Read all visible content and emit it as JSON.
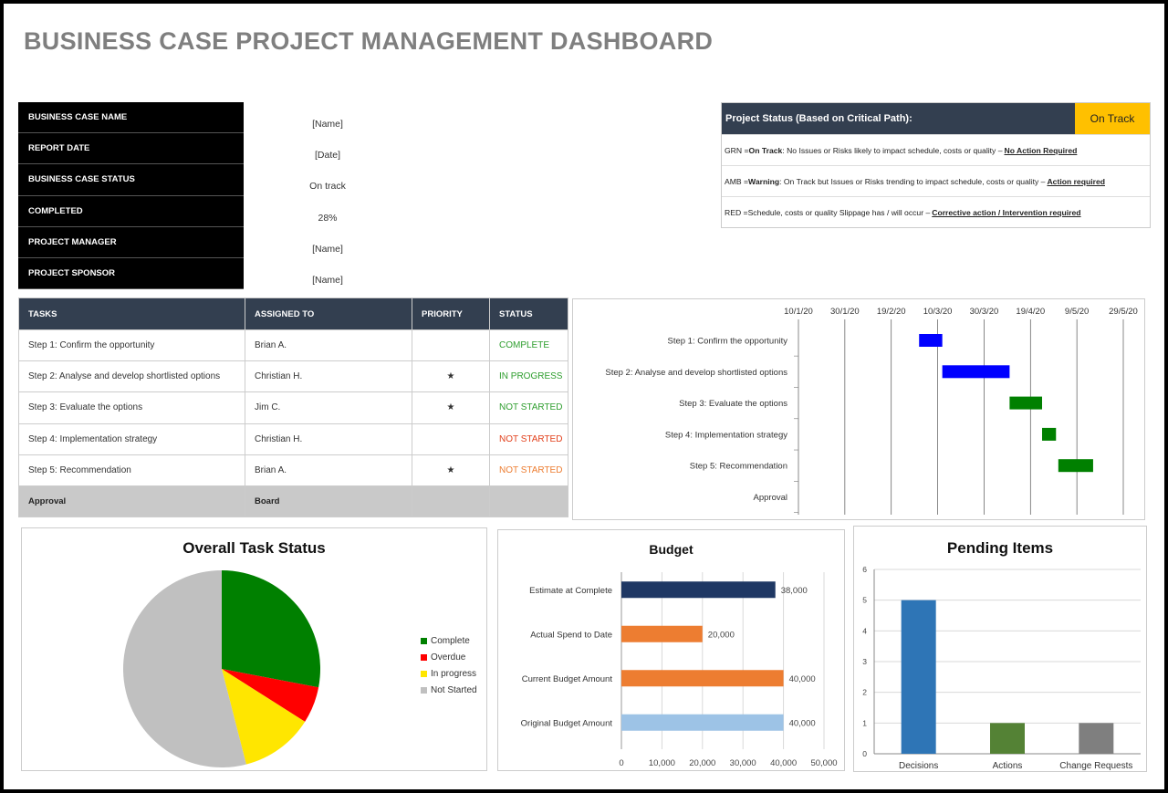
{
  "title": "BUSINESS CASE PROJECT MANAGEMENT DASHBOARD",
  "info": [
    {
      "label": "BUSINESS CASE NAME",
      "value": "[Name]"
    },
    {
      "label": "REPORT DATE",
      "value": "[Date]"
    },
    {
      "label": "BUSINESS CASE STATUS",
      "value": "On track"
    },
    {
      "label": "COMPLETED",
      "value": "28%"
    },
    {
      "label": "PROJECT MANAGER",
      "value": "[Name]"
    },
    {
      "label": "PROJECT SPONSOR",
      "value": "[Name]"
    }
  ],
  "project_status": {
    "label": "Project Status (Based on Critical Path):",
    "value": "On Track",
    "value_color": "#ffc000",
    "legend": [
      {
        "prefix": "GRN = ",
        "bold": "On Track",
        "text": ": No Issues or Risks likely to impact schedule, costs or quality – ",
        "action": "No Action Required"
      },
      {
        "prefix": "AMB = ",
        "bold": "Warning",
        "text": ": On Track but Issues or Risks trending to impact schedule, costs or quality – ",
        "action": "Action required"
      },
      {
        "prefix": "RED = ",
        "bold": "",
        "text": "Schedule, costs or quality Slippage has / will occur – ",
        "action": "Corrective action / Intervention required"
      }
    ]
  },
  "tasks": {
    "headers": [
      "TASKS",
      "ASSIGNED TO",
      "PRIORITY",
      "STATUS"
    ],
    "rows": [
      {
        "task": "Step 1: Confirm the opportunity",
        "assigned": "Brian A.",
        "priority": "",
        "status": "COMPLETE",
        "status_color": "#2e9e2e"
      },
      {
        "task": "Step 2: Analyse and develop shortlisted options",
        "assigned": "Christian H.",
        "priority": "★",
        "status": "IN PROGRESS",
        "status_color": "#2e9e2e"
      },
      {
        "task": "Step 3: Evaluate the options",
        "assigned": "Jim C.",
        "priority": "★",
        "status": "NOT STARTED",
        "status_color": "#2e9e2e"
      },
      {
        "task": "Step 4: Implementation strategy",
        "assigned": "Christian H.",
        "priority": "",
        "status": "NOT STARTED",
        "status_color": "#e2401c"
      },
      {
        "task": "Step 5: Recommendation",
        "assigned": "Brian A.",
        "priority": "★",
        "status": "NOT STARTED",
        "status_color": "#ed7d31"
      }
    ],
    "approval": {
      "task": "Approval",
      "assigned": "Board"
    }
  },
  "chart_data": [
    {
      "type": "gantt",
      "title": "",
      "x_ticks": [
        "10/1/20",
        "30/1/20",
        "19/2/20",
        "10/3/20",
        "30/3/20",
        "19/4/20",
        "9/5/20",
        "29/5/20"
      ],
      "xlim": [
        "2020-01-10",
        "2020-05-29"
      ],
      "tasks": [
        {
          "name": "Step 1: Confirm the opportunity",
          "start": "2020-03-02",
          "duration_days": 10,
          "color": "#0000ff"
        },
        {
          "name": "Step 2: Analyse and develop shortlisted options",
          "start": "2020-03-12",
          "duration_days": 29,
          "color": "#0000ff"
        },
        {
          "name": "Step 3: Evaluate the options",
          "start": "2020-04-10",
          "duration_days": 14,
          "color": "#008000"
        },
        {
          "name": "Step 4: Implementation strategy",
          "start": "2020-04-24",
          "duration_days": 6,
          "color": "#008000"
        },
        {
          "name": "Step 5: Recommendation",
          "start": "2020-05-01",
          "duration_days": 15,
          "color": "#008000"
        },
        {
          "name": "Approval",
          "start": null,
          "duration_days": 0,
          "color": "#008000"
        }
      ],
      "grid": true
    },
    {
      "type": "pie",
      "title": "Overall Task Status",
      "labels": [
        "Complete",
        "Overdue",
        "In progress",
        "Not Started"
      ],
      "values": [
        28,
        6,
        12,
        54
      ],
      "colors": [
        "#008000",
        "#ff0000",
        "#ffe600",
        "#c0c0c0"
      ],
      "legend": "right"
    },
    {
      "type": "bar",
      "orientation": "horizontal",
      "title": "Budget",
      "categories": [
        "Estimate at Complete",
        "Actual Spend to Date",
        "Current Budget Amount",
        "Original Budget Amount"
      ],
      "values": [
        38000,
        20000,
        40000,
        40000
      ],
      "value_labels": [
        "38,000",
        "20,000",
        "40,000",
        "40,000"
      ],
      "colors": [
        "#1f3864",
        "#ed7d31",
        "#ed7d31",
        "#9dc3e6"
      ],
      "x_ticks": [
        "0",
        "10,000",
        "20,000",
        "30,000",
        "40,000",
        "50,000"
      ],
      "xlim": [
        0,
        50000
      ],
      "grid": true
    },
    {
      "type": "bar",
      "title": "Pending Items",
      "categories": [
        "Decisions",
        "Actions",
        "Change Requests"
      ],
      "values": [
        5,
        1,
        1
      ],
      "colors": [
        "#2e75b6",
        "#548235",
        "#7f7f7f"
      ],
      "y_ticks": [
        "0",
        "1",
        "2",
        "3",
        "4",
        "5",
        "6"
      ],
      "ylim": [
        0,
        6
      ],
      "grid": true
    }
  ]
}
